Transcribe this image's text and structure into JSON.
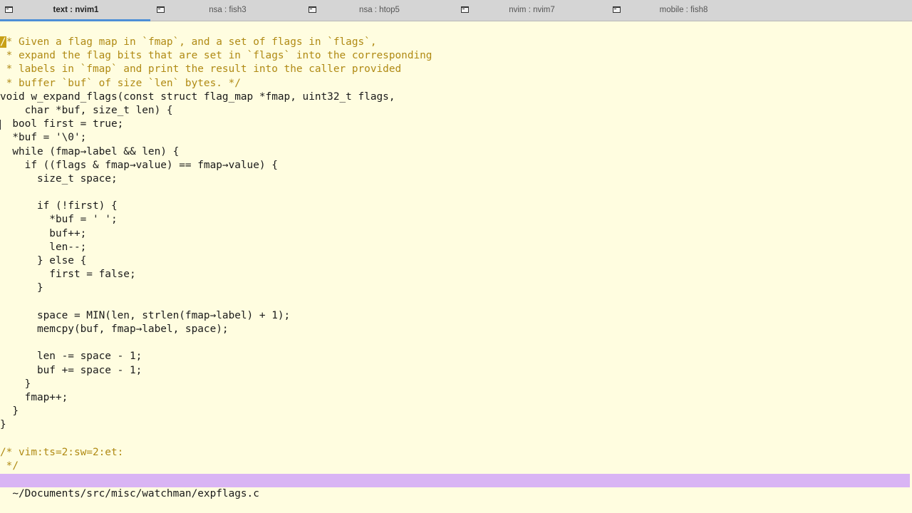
{
  "tabs": [
    {
      "label": "text : nvim1",
      "active": true
    },
    {
      "label": "nsa : fish3",
      "active": false
    },
    {
      "label": "nsa : htop5",
      "active": false
    },
    {
      "label": "nvim : nvim7",
      "active": false
    },
    {
      "label": "mobile : fish8",
      "active": false
    }
  ],
  "editor": {
    "first_char": "/",
    "lines": [
      {
        "text": "* Given a flag map in `fmap`, and a set of flags in `flags`,",
        "kind": "comment"
      },
      {
        "text": " * expand the flag bits that are set in `flags` into the corresponding",
        "kind": "comment"
      },
      {
        "text": " * labels in `fmap` and print the result into the caller provided",
        "kind": "comment"
      },
      {
        "text": " * buffer `buf` of size `len` bytes. */",
        "kind": "comment"
      },
      {
        "text": "void w_expand_flags(const struct flag_map *fmap, uint32_t flags,",
        "kind": "code"
      },
      {
        "text": "    char *buf, size_t len) {",
        "kind": "code"
      },
      {
        "text": "  bool first = true;",
        "kind": "code"
      },
      {
        "text": "  *buf = '\\0';",
        "kind": "code"
      },
      {
        "text": "  while (fmap→label && len) {",
        "kind": "code"
      },
      {
        "text": "    if ((flags & fmap→value) == fmap→value) {",
        "kind": "code"
      },
      {
        "text": "      size_t space;",
        "kind": "code"
      },
      {
        "text": "",
        "kind": "code"
      },
      {
        "text": "      if (!first) {",
        "kind": "code"
      },
      {
        "text": "        *buf = ' ';",
        "kind": "code"
      },
      {
        "text": "        buf++;",
        "kind": "code"
      },
      {
        "text": "        len--;",
        "kind": "code"
      },
      {
        "text": "      } else {",
        "kind": "code"
      },
      {
        "text": "        first = false;",
        "kind": "code"
      },
      {
        "text": "      }",
        "kind": "code"
      },
      {
        "text": "",
        "kind": "code"
      },
      {
        "text": "      space = MIN(len, strlen(fmap→label) + 1);",
        "kind": "code"
      },
      {
        "text": "      memcpy(buf, fmap→label, space);",
        "kind": "code"
      },
      {
        "text": "",
        "kind": "code"
      },
      {
        "text": "      len -= space - 1;",
        "kind": "code"
      },
      {
        "text": "      buf += space - 1;",
        "kind": "code"
      },
      {
        "text": "    }",
        "kind": "code"
      },
      {
        "text": "    fmap++;",
        "kind": "code"
      },
      {
        "text": "  }",
        "kind": "code"
      },
      {
        "text": "}",
        "kind": "code"
      },
      {
        "text": "",
        "kind": "code"
      },
      {
        "text": "/* vim:ts=2:sw=2:et:",
        "kind": "comment"
      },
      {
        "text": " */",
        "kind": "comment"
      }
    ]
  },
  "statusline": {
    "path": "~/Documents/src/misc/watchman/expflags.c"
  },
  "colors": {
    "background": "#fffde0",
    "comment": "#b08a14",
    "cursor": "#c8a017",
    "statusline": "#d9b4f4",
    "active_tab_underline": "#4d8fd6"
  }
}
